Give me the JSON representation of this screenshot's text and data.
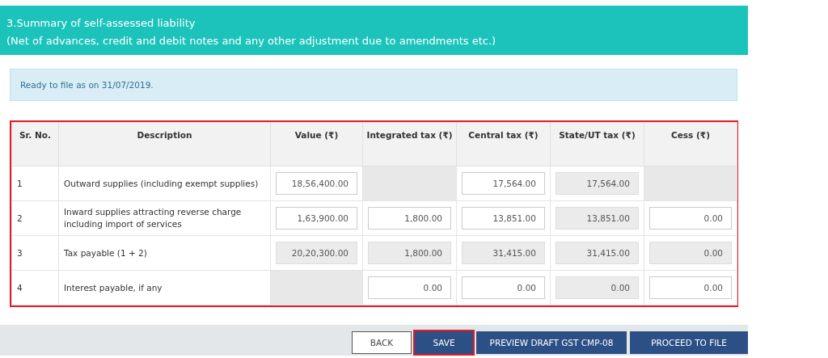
{
  "header": {
    "title": "3.Summary of self-assessed liability",
    "subtitle": "(Net of advances, credit and debit notes and any other adjustment due to amendments etc.)"
  },
  "notice": "Ready to file as on 31/07/2019.",
  "table": {
    "highlighted": true,
    "columns": [
      "Sr. No.",
      "Description",
      "Value (₹)",
      "Integrated tax (₹)",
      "Central tax (₹)",
      "State/UT tax (₹)",
      "Cess (₹)"
    ],
    "rows": [
      {
        "cells": [
          {
            "kind": "text",
            "value": "1"
          },
          {
            "kind": "text",
            "value": "Outward supplies (including exempt supplies)"
          },
          {
            "kind": "input",
            "value": "18,56,400.00"
          },
          {
            "kind": "empty"
          },
          {
            "kind": "input",
            "value": "17,564.00"
          },
          {
            "kind": "readonly",
            "value": "17,564.00"
          },
          {
            "kind": "empty"
          }
        ]
      },
      {
        "cells": [
          {
            "kind": "text",
            "value": "2"
          },
          {
            "kind": "text",
            "value": "Inward supplies attracting reverse charge including import of services"
          },
          {
            "kind": "input",
            "value": "1,63,900.00"
          },
          {
            "kind": "input",
            "value": "1,800.00"
          },
          {
            "kind": "input",
            "value": "13,851.00"
          },
          {
            "kind": "readonly",
            "value": "13,851.00"
          },
          {
            "kind": "input",
            "value": "0.00"
          }
        ]
      },
      {
        "cells": [
          {
            "kind": "text",
            "value": "3"
          },
          {
            "kind": "text",
            "value": "Tax payable (1 + 2)"
          },
          {
            "kind": "readonly",
            "value": "20,20,300.00"
          },
          {
            "kind": "readonly",
            "value": "1,800.00"
          },
          {
            "kind": "readonly",
            "value": "31,415.00"
          },
          {
            "kind": "readonly",
            "value": "31,415.00"
          },
          {
            "kind": "readonly",
            "value": "0.00"
          }
        ]
      },
      {
        "cells": [
          {
            "kind": "text",
            "value": "4"
          },
          {
            "kind": "text",
            "value": "Interest payable, if any"
          },
          {
            "kind": "empty"
          },
          {
            "kind": "input",
            "value": "0.00"
          },
          {
            "kind": "input",
            "value": "0.00"
          },
          {
            "kind": "readonly",
            "value": "0.00"
          },
          {
            "kind": "input",
            "value": "0.00"
          }
        ]
      }
    ]
  },
  "buttons": [
    {
      "label": "BACK",
      "kind": "outline",
      "highlighted": false
    },
    {
      "label": "SAVE",
      "kind": "primary",
      "highlighted": true
    },
    {
      "label": "PREVIEW DRAFT GST CMP-08",
      "kind": "primary",
      "highlighted": false
    },
    {
      "label": "PROCEED TO FILE",
      "kind": "primary",
      "highlighted": false
    }
  ]
}
